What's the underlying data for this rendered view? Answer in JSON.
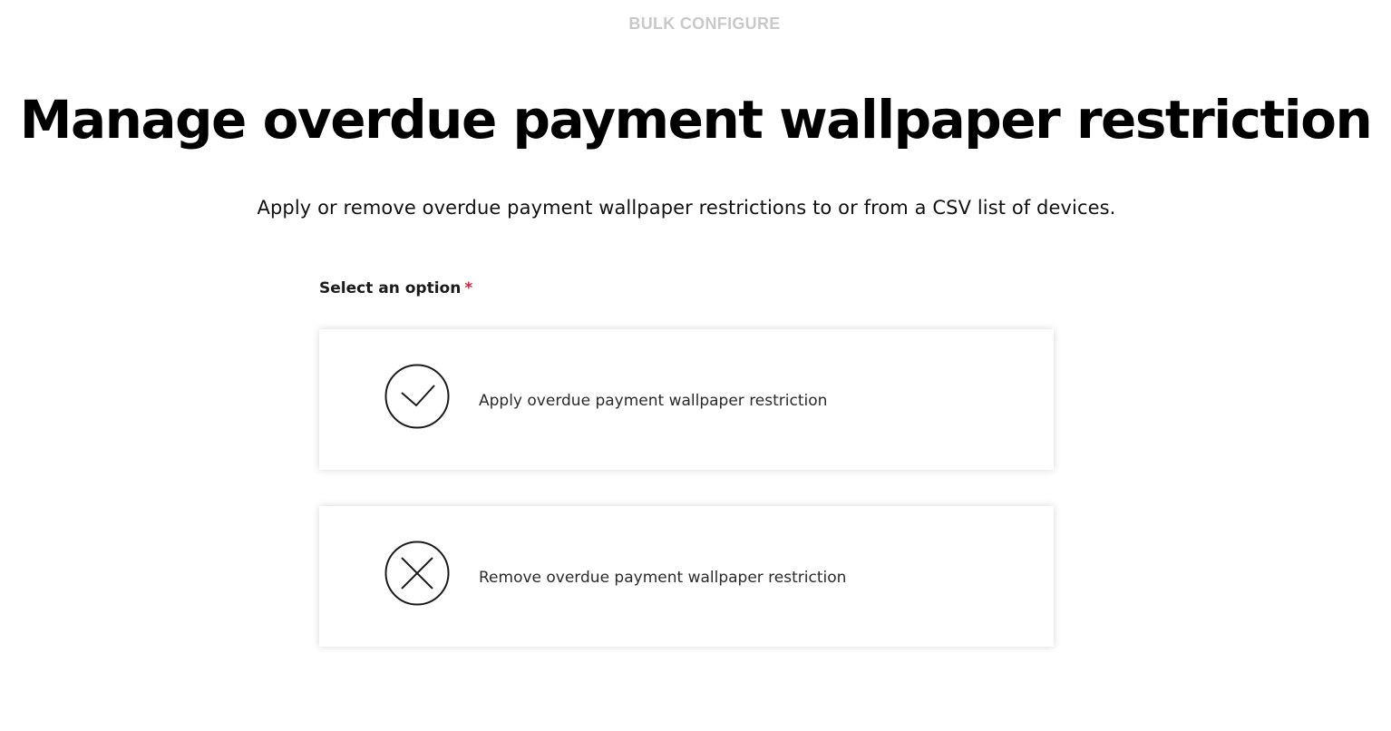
{
  "header": {
    "eyebrow": "BULK CONFIGURE",
    "title": "Manage overdue payment wallpaper restriction",
    "subtitle": "Apply or remove overdue payment wallpaper restrictions to or from a CSV list of devices."
  },
  "form": {
    "label": "Select an option",
    "required_marker": "*",
    "options": [
      {
        "label": "Apply overdue payment wallpaper restriction",
        "icon": "check-circle-icon"
      },
      {
        "label": "Remove overdue payment wallpaper restriction",
        "icon": "x-circle-icon"
      }
    ]
  },
  "colors": {
    "eyebrow": "#c9c9c9",
    "required": "#d0243c",
    "title": "#000000"
  }
}
